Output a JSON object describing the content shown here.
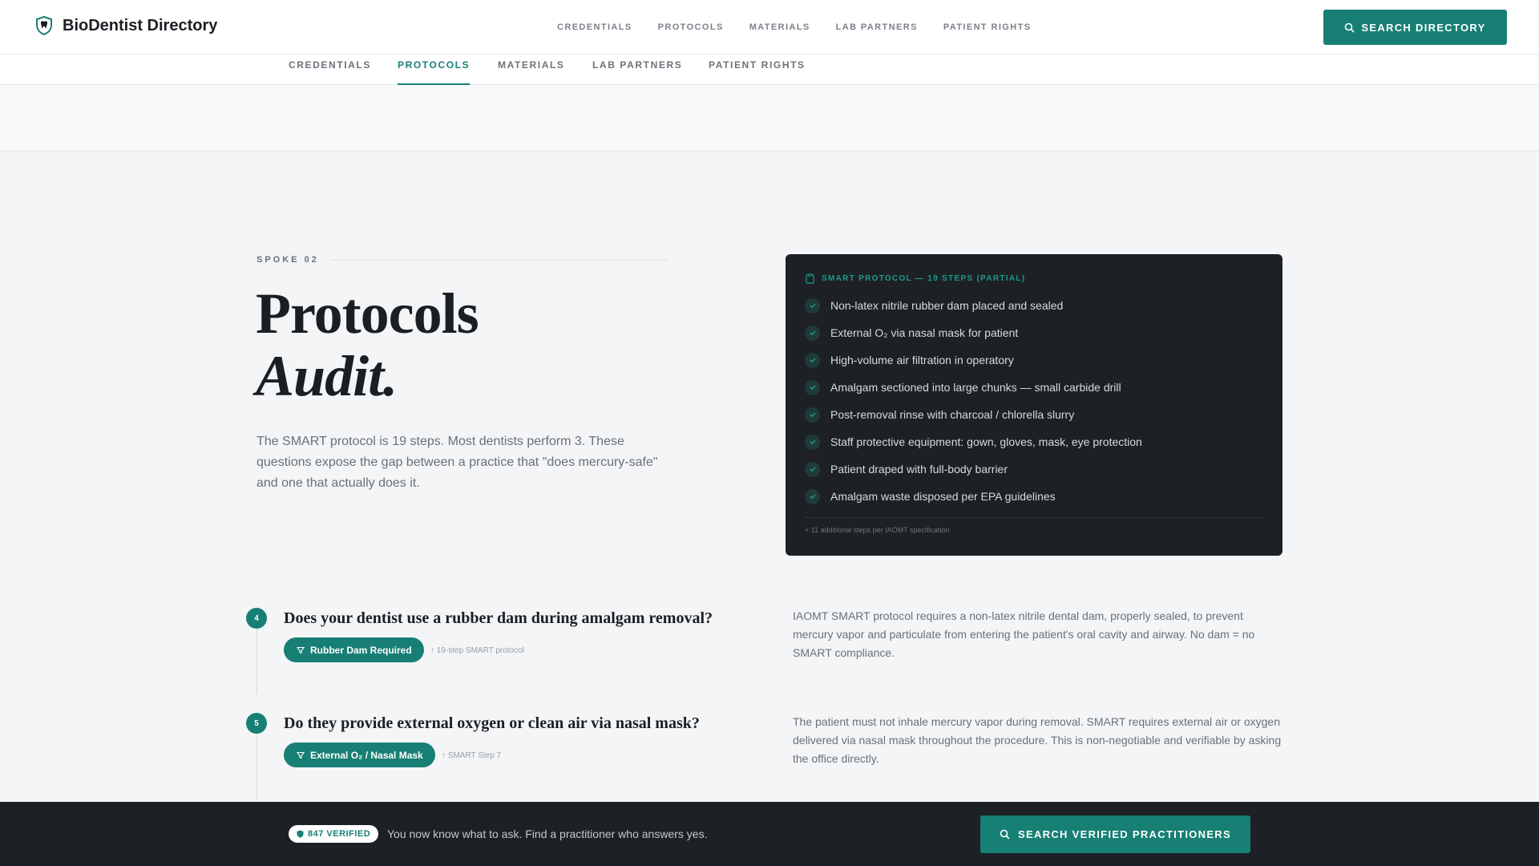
{
  "colors": {
    "accent": "#177f74",
    "dark": "#1d2126",
    "page_bg": "#f3f5f6"
  },
  "brand": {
    "name": "BioDentist Directory",
    "icon": "tooth-shield-icon"
  },
  "topnav": [
    "CREDENTIALS",
    "PROTOCOLS",
    "MATERIALS",
    "LAB PARTNERS",
    "PATIENT RIGHTS"
  ],
  "header_button": {
    "label": "SEARCH DIRECTORY",
    "icon": "search-icon"
  },
  "subtabs": {
    "items": [
      "CREDENTIALS",
      "PROTOCOLS",
      "MATERIALS",
      "LAB PARTNERS",
      "PATIENT RIGHTS"
    ],
    "active": "PROTOCOLS"
  },
  "hero": {
    "eyebrow": "SPOKE 02",
    "title_line1": "Protocols",
    "title_line2": "Audit.",
    "description": "The SMART protocol is 19 steps. Most dentists perform 3. These questions expose the gap between a practice that \"does mercury-safe\" and one that actually does it."
  },
  "protocol_card": {
    "heading": "SMART PROTOCOL — 19 STEPS (PARTIAL)",
    "icon": "clipboard-icon",
    "steps": [
      "Non-latex nitrile rubber dam placed and sealed",
      "External O₂ via nasal mask for patient",
      "High-volume air filtration in operatory",
      "Amalgam sectioned into large chunks — small carbide drill",
      "Post-removal rinse with charcoal / chlorella slurry",
      "Staff protective equipment: gown, gloves, mask, eye protection",
      "Patient draped with full-body barrier",
      "Amalgam waste disposed per EPA guidelines"
    ],
    "footnote": "+ 11 additional steps per IAOMT specification"
  },
  "questions": [
    {
      "number": "4",
      "question": "Does your dentist use a rubber dam during amalgam removal?",
      "pill": "Rubber Dam Required",
      "reference": "↑ 19-step SMART protocol",
      "answer": "IAOMT SMART protocol requires a non-latex nitrile dental dam, properly sealed, to prevent mercury vapor and particulate from entering the patient's oral cavity and airway. No dam = no SMART compliance."
    },
    {
      "number": "5",
      "question": "Do they provide external oxygen or clean air via nasal mask?",
      "pill": "External O₂ / Nasal Mask",
      "reference": "↑ SMART Step 7",
      "answer": "The patient must not inhale mercury vapor during removal. SMART requires external air or oxygen delivered via nasal mask throughout the procedure. This is non-negotiable and verifiable by asking the office directly."
    }
  ],
  "bottom_bar": {
    "badge": "847 VERIFIED",
    "text": "You now know what to ask. Find a practitioner who answers yes.",
    "button": "SEARCH VERIFIED PRACTITIONERS"
  }
}
